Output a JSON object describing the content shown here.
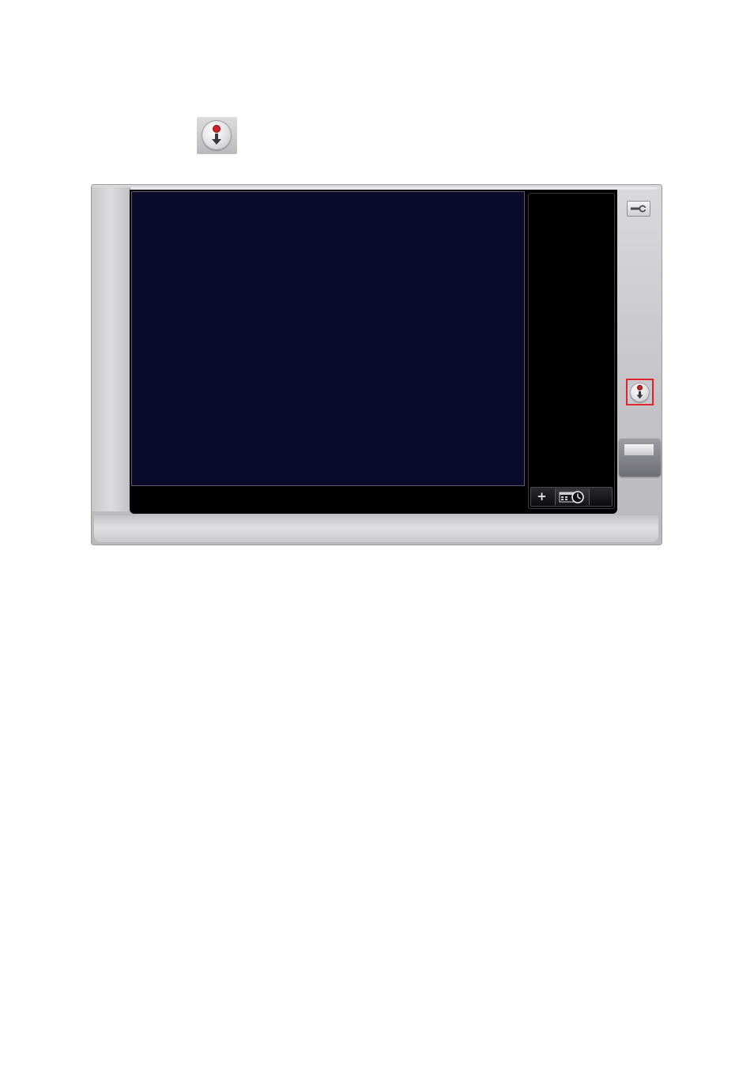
{
  "icons": {
    "preview": "record-download-icon",
    "settings": "wrench-icon",
    "record": "record-download-icon",
    "add": "plus-icon",
    "schedule": "schedule-clock-icon"
  },
  "toolbar": {
    "add_label": "+"
  },
  "colors": {
    "video_background": "#0a0b2a",
    "highlight": "#e0242c",
    "record_dot": "#d4202a"
  }
}
